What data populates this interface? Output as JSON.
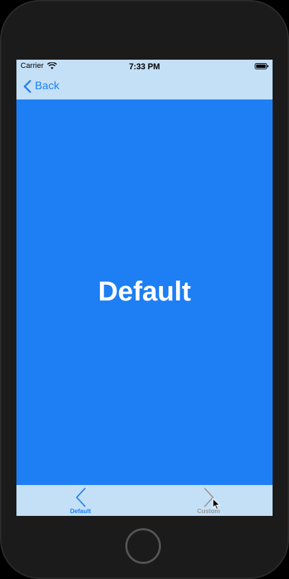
{
  "status_bar": {
    "carrier": "Carrier",
    "time": "7:33 PM"
  },
  "nav": {
    "back_label": "Back"
  },
  "main": {
    "title": "Default"
  },
  "tabs": [
    {
      "label": "Default",
      "icon": "chevron-left-icon",
      "selected": true
    },
    {
      "label": "Custom",
      "icon": "chevron-right-icon",
      "selected": false
    }
  ],
  "colors": {
    "accent": "#1e7ff5",
    "bar_background": "#c4e0f7",
    "device_frame": "#1b1b1b",
    "inactive_tab": "#999999"
  }
}
